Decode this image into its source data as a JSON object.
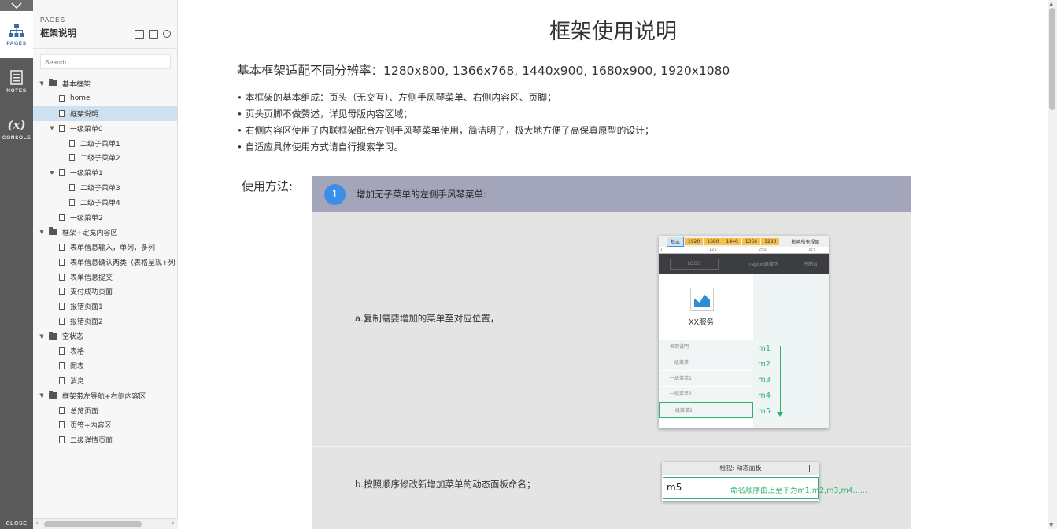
{
  "rail": {
    "items": [
      {
        "label": "PAGES",
        "icon": "sitemap-icon"
      },
      {
        "label": "NOTES",
        "icon": "notes-icon"
      },
      {
        "label": "CONSOLE",
        "icon": "variable-icon",
        "glyph": "(x)"
      }
    ],
    "close_label": "CLOSE"
  },
  "panel": {
    "title": "PAGES",
    "current_page": "框架说明",
    "search_placeholder": "Search",
    "tree": [
      {
        "label": "基本框架",
        "type": "folder",
        "depth": 0,
        "expanded": true
      },
      {
        "label": "home",
        "type": "page",
        "depth": 1
      },
      {
        "label": "框架说明",
        "type": "page",
        "depth": 1,
        "selected": true
      },
      {
        "label": "一级菜单0",
        "type": "page",
        "depth": 1,
        "expanded": true
      },
      {
        "label": "二级子菜单1",
        "type": "page",
        "depth": 2
      },
      {
        "label": "二级子菜单2",
        "type": "page",
        "depth": 2
      },
      {
        "label": "一级菜单1",
        "type": "page",
        "depth": 1,
        "expanded": true
      },
      {
        "label": "二级子菜单3",
        "type": "page",
        "depth": 2
      },
      {
        "label": "二级子菜单4",
        "type": "page",
        "depth": 2
      },
      {
        "label": "一级菜单2",
        "type": "page",
        "depth": 1
      },
      {
        "label": "框架+定宽内容区",
        "type": "folder",
        "depth": 0,
        "expanded": true
      },
      {
        "label": "表单信息输入，单列，多列",
        "type": "page",
        "depth": 1
      },
      {
        "label": "表单信息确认两类（表格呈现+列",
        "type": "page",
        "depth": 1
      },
      {
        "label": "表单信息提交",
        "type": "page",
        "depth": 1
      },
      {
        "label": "支付成功页面",
        "type": "page",
        "depth": 1
      },
      {
        "label": "报错页面1",
        "type": "page",
        "depth": 1
      },
      {
        "label": "报错页面2",
        "type": "page",
        "depth": 1
      },
      {
        "label": "空状态",
        "type": "folder",
        "depth": 0,
        "expanded": true
      },
      {
        "label": "表格",
        "type": "page",
        "depth": 1
      },
      {
        "label": "图表",
        "type": "page",
        "depth": 1
      },
      {
        "label": "消息",
        "type": "page",
        "depth": 1
      },
      {
        "label": "框架带左导航+右侧内容区",
        "type": "folder",
        "depth": 0,
        "expanded": true
      },
      {
        "label": "总览页面",
        "type": "page",
        "depth": 1
      },
      {
        "label": "页签+内容区",
        "type": "page",
        "depth": 1
      },
      {
        "label": "二级详情页面",
        "type": "page",
        "depth": 1
      }
    ]
  },
  "main": {
    "title": "框架使用说明",
    "subheading": "基本框架适配不同分辨率：1280x800, 1366x768, 1440x900, 1680x900, 1920x1080",
    "bullets": [
      "• 本框架的基本组成：页头（无交互）、左侧手风琴菜单、右侧内容区、页脚；",
      "• 页头页脚不做赘述，详见母版内容区域；",
      "• 右侧内容区使用了内联框架配合左侧手风琴菜单使用，简洁明了，极大地方便了高保真原型的设计；",
      "• 自适应具体使用方式请自行搜索学习。"
    ],
    "usage_label": "使用方法:",
    "step": {
      "number": "1",
      "text": "增加无子菜单的左侧手风琴菜单:"
    },
    "row_a_label": "a.复制需要增加的菜单至对应位置，",
    "row_b_label": "b.按照顺序修改新增加菜单的动态面板命名；"
  },
  "mock_a": {
    "tabs": [
      "基本",
      "1920",
      "1680",
      "1440",
      "1366",
      "1280"
    ],
    "checkbox_label": "影响所有视图",
    "ruler": [
      "0",
      "125",
      "250",
      "375"
    ],
    "logo": "LOGO",
    "region": "region选择区",
    "control": "控制台",
    "service": "XX服务",
    "menu": [
      "框架说明",
      "一级菜单",
      "一级菜单1",
      "一级菜单2",
      "一级菜单2"
    ],
    "labels": [
      "m1",
      "m2",
      "m3",
      "m4",
      "m5"
    ]
  },
  "mock_b": {
    "header": "检视: 动态面板",
    "value": "m5",
    "hint": "命名顺序由上至下为m1,m2,m3,m4......"
  },
  "colors": {
    "step_header": "#a3a6bb",
    "step_number": "#3d8ee6",
    "accent_green": "#2fb36b",
    "selected_row": "#cfe0ee"
  }
}
